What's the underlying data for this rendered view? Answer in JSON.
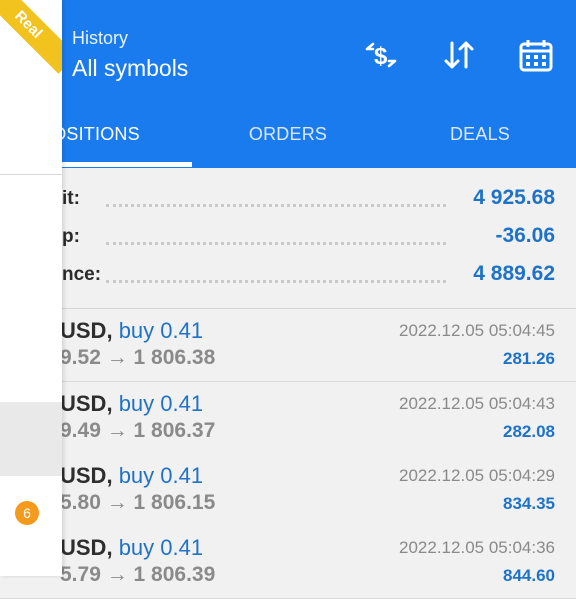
{
  "header": {
    "subtitle": "History",
    "title": "All symbols",
    "icons": [
      "currency-exchange-icon",
      "sort-icon",
      "calendar-icon"
    ],
    "color": "#1a7bef"
  },
  "tabs": [
    {
      "label": "OSITIONS",
      "active": true
    },
    {
      "label": "ORDERS",
      "active": false
    },
    {
      "label": "DEALS",
      "active": false
    }
  ],
  "summary": [
    {
      "label": "it:",
      "value": "4 925.68"
    },
    {
      "label": "p:",
      "value": "-36.06"
    },
    {
      "label": "nce:",
      "value": "4 889.62"
    }
  ],
  "trades": [
    {
      "symbol": "USD,",
      "direction": "buy 0.41",
      "prices": "9.52 → 1 806.38",
      "time": "2022.12.05 05:04:45",
      "profit": "281.26"
    },
    {
      "symbol": "USD,",
      "direction": "buy 0.41",
      "prices": "9.49 → 1 806.37",
      "time": "2022.12.05 05:04:43",
      "profit": "282.08"
    },
    {
      "symbol": "USD,",
      "direction": "buy 0.41",
      "prices": "5.80 → 1 806.15",
      "time": "2022.12.05 05:04:29",
      "profit": "834.35"
    },
    {
      "symbol": "USD,",
      "direction": "buy 0.41",
      "prices": "5.79 → 1 806.39",
      "time": "2022.12.05 05:04:36",
      "profit": "844.60"
    }
  ],
  "drawer": {
    "ribbon": "Real",
    "badge": "6"
  },
  "colors": {
    "accent": "#1a7bef",
    "value_blue": "#1e73c9",
    "ribbon": "#f2c21f",
    "badge": "#f49a1c"
  }
}
